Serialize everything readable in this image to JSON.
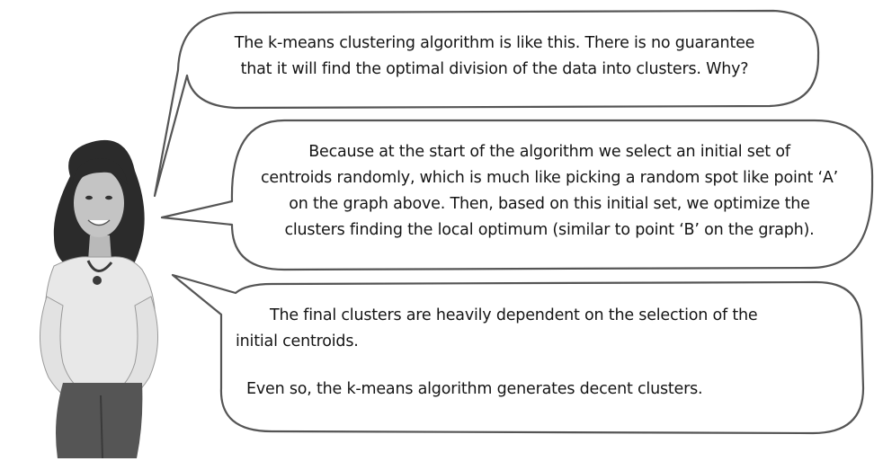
{
  "bubbles": [
    {
      "lines": [
        "The k-means clustering algorithm is like this. There is no guarantee",
        "that it will find the optimal division of the data into clusters. Why?"
      ]
    },
    {
      "lines": [
        "Because at the start of the algorithm we select an initial set of",
        "centroids randomly, which is much like picking a random spot like point ‘A’",
        "on the graph above. Then, based on this initial set, we optimize the",
        "clusters finding the local optimum (similar to point ‘B’ on the graph)."
      ]
    },
    {
      "lines": [
        "The final clusters are heavily dependent on the selection of the",
        "initial centroids.",
        "Even so, the k-means algorithm generates decent clusters."
      ]
    }
  ],
  "colors": {
    "outline": "#555555",
    "text": "#151515",
    "background": "#ffffff"
  }
}
